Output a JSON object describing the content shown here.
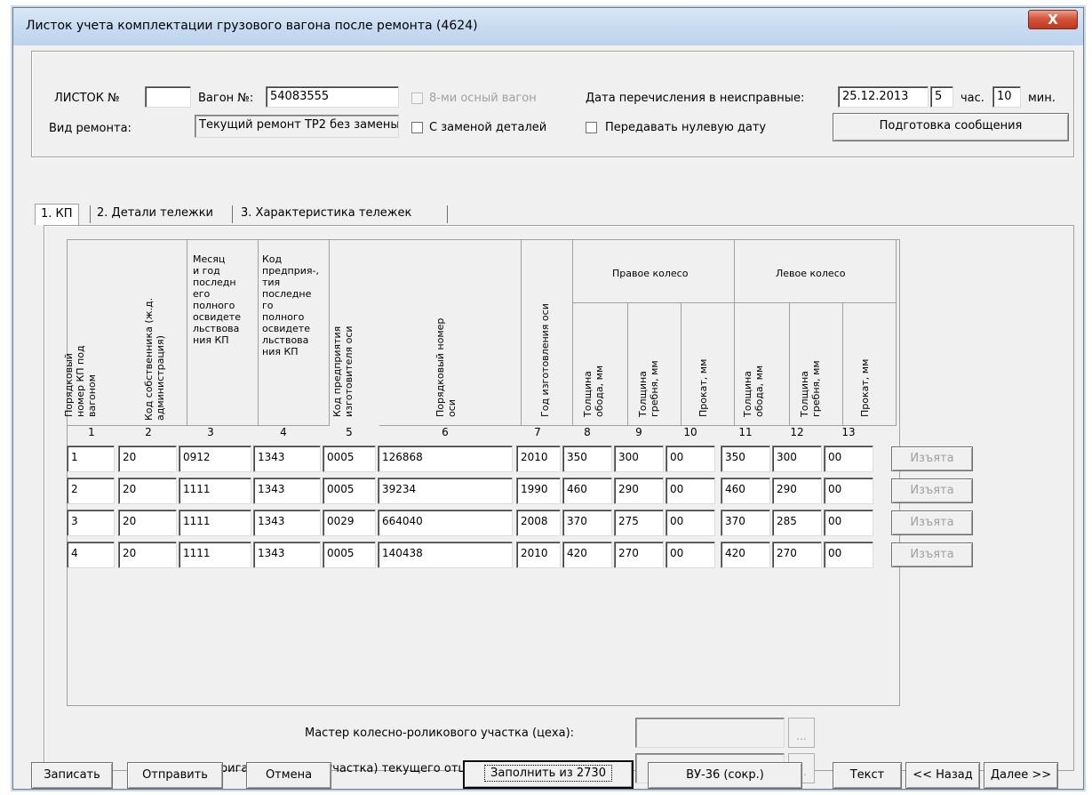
{
  "window": {
    "title": "Листок учета комплектации грузового вагона после ремонта (4624)",
    "close_glyph": "X"
  },
  "header": {
    "listok_label": "ЛИСТОК №",
    "listok_value": "",
    "vagon_label": "Вагон №:",
    "vagon_value": "54083555",
    "eight_axle_label": "8-ми осный вагон",
    "date_label": "Дата перечисления в неисправные:",
    "date_value": "25.12.2013",
    "hour_value": "5",
    "hour_label": "час.",
    "min_value": "10",
    "min_label": "мин.",
    "repair_type_label": "Вид ремонта:",
    "repair_type_value": "Текущий ремонт ТР2 без замены",
    "replace_parts_label": "С заменой деталей",
    "zero_date_label": "Передавать нулевую дату",
    "prepare_button": "Подготовка сообщения"
  },
  "tabs": [
    {
      "label": "1. КП"
    },
    {
      "label": "2. Детали тележки"
    },
    {
      "label": "3. Характеристика тележек"
    }
  ],
  "grid": {
    "headers": {
      "c1": "Порядковый\nномер КП под\nвагоном",
      "c2": "Код собственника (ж.д.\nадминистрация)",
      "c3": "Месяц\nи год\nпоследн\nего\nполного\nосвидете\nльствова\nния КП",
      "c4": "Код\nпредприя-,\nтия\nпоследне\nго\nполного\nосвидете\nльствова\nния КП",
      "c5": "Код предприятия\nизготовителя оси",
      "c6": "Порядковый номер\nоси",
      "c7": "Год изготовления оси",
      "right_wheel": "Правое колесо",
      "left_wheel": "Левое колесо",
      "c8": "Толщина\nобода, мм",
      "c9": "Толщина\nгребня, мм",
      "c10": "Прокат, мм",
      "c11": "Толщина\nобода, мм",
      "c12": "Толщина\nгребня, мм",
      "c13": "Прокат, мм"
    },
    "column_numbers": [
      "1",
      "2",
      "3",
      "4",
      "5",
      "6",
      "7",
      "8",
      "9",
      "10",
      "11",
      "12",
      "13"
    ],
    "rows": [
      [
        "1",
        "20",
        "0912",
        "1343",
        "0005",
        "126868",
        "2010",
        "350",
        "300",
        "00",
        "350",
        "300",
        "00"
      ],
      [
        "2",
        "20",
        "1111",
        "1343",
        "0005",
        "39234",
        "1990",
        "460",
        "290",
        "00",
        "460",
        "290",
        "00"
      ],
      [
        "3",
        "20",
        "1111",
        "1343",
        "0029",
        "664040",
        "2008",
        "370",
        "275",
        "00",
        "370",
        "285",
        "00"
      ],
      [
        "4",
        "20",
        "1111",
        "1343",
        "0005",
        "140438",
        "2010",
        "420",
        "270",
        "00",
        "420",
        "270",
        "00"
      ]
    ],
    "row_button": "Изъята"
  },
  "signers": {
    "master_label": "Мастер колесно-роликового участка (цеха):",
    "brigadier_label": "Бригадир пункта (участка) текущего отцепочного ремонта:",
    "ellipsis": "..."
  },
  "footer": {
    "save": "Записать",
    "send": "Отправить",
    "cancel": "Отмена",
    "fill_2730": "Заполнить из 2730",
    "vu36": "ВУ-36 (сокр.)",
    "text": "Текст",
    "back": "<< Назад",
    "next": "Далее >>"
  }
}
